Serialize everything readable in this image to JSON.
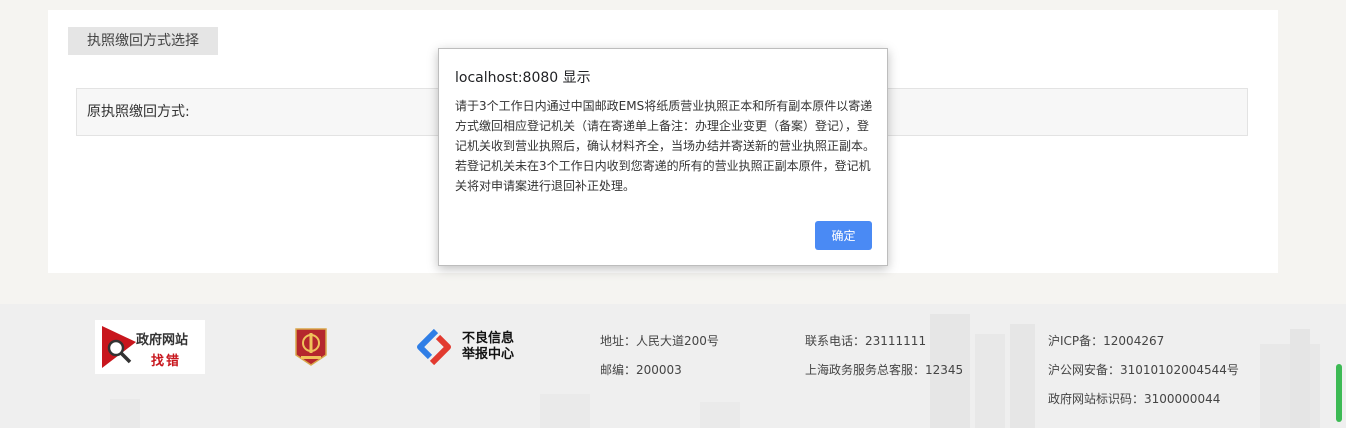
{
  "page": {
    "section_tab": "执照缴回方式选择",
    "method_label": "原执照缴回方式:"
  },
  "dialog": {
    "title": "localhost:8080 显示",
    "message": "请于3个工作日内通过中国邮政EMS将纸质营业执照正本和所有副本原件以寄递方式缴回相应登记机关（请在寄递单上备注：办理企业变更（备案）登记），登记机关收到营业执照后，确认材料齐全，当场办结并寄送新的营业执照正副本。若登记机关未在3个工作日内收到您寄递的所有的营业执照正副本原件，登记机关将对申请案进行退回补正处理。",
    "ok_label": "确定",
    "ok_color": "#4a8af4"
  },
  "footer": {
    "gov_logo": {
      "line1": "政府网站",
      "line2": "找错"
    },
    "report_logo": {
      "line1": "不良信息",
      "line2": "举报中心"
    },
    "address": "地址：人民大道200号",
    "postcode": "邮编：200003",
    "phone": "联系电话：23111111",
    "hotline": "上海政务服务总客服：12345",
    "icp": "沪ICP备：12004267",
    "police": "沪公网安备：31010102004544号",
    "site_code": "政府网站标识码：3100000044"
  },
  "icons": [
    "search-icon",
    "party-emblem-icon",
    "report-center-icon"
  ],
  "colors": {
    "accent": "#4a8af4",
    "brand_red": "#c8161d",
    "scrollbar": "#3cba54"
  }
}
